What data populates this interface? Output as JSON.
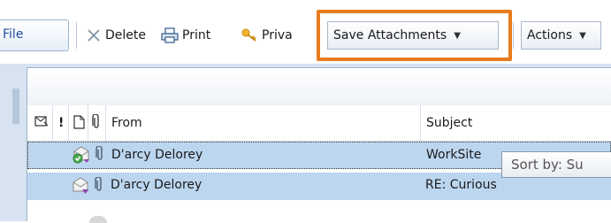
{
  "toolbar": {
    "file_label": "File",
    "delete_label": "Delete",
    "print_label": "Print",
    "private_label": "Priva",
    "save_attachments_label": "Save Attachments",
    "actions_label": "Actions"
  },
  "columns": {
    "from": "From",
    "subject": "Subject",
    "flag_symbol": "!"
  },
  "messages": [
    {
      "from": "D'arcy Delorey",
      "subject": "WorkSite"
    },
    {
      "from": "D'arcy Delorey",
      "subject": "RE: Curious"
    }
  ],
  "tooltip": {
    "text": "Sort by: Su"
  },
  "colors": {
    "highlight": "#e87b1f",
    "selected_row": "#bcd6ef",
    "band": "#d7e3f1"
  },
  "icons": [
    "delete-x-icon",
    "printer-icon",
    "key-icon",
    "dropdown-caret-icon",
    "envelope-column-icon",
    "page-column-icon",
    "attachment-column-icon",
    "message-status-icon",
    "paperclip-icon"
  ]
}
